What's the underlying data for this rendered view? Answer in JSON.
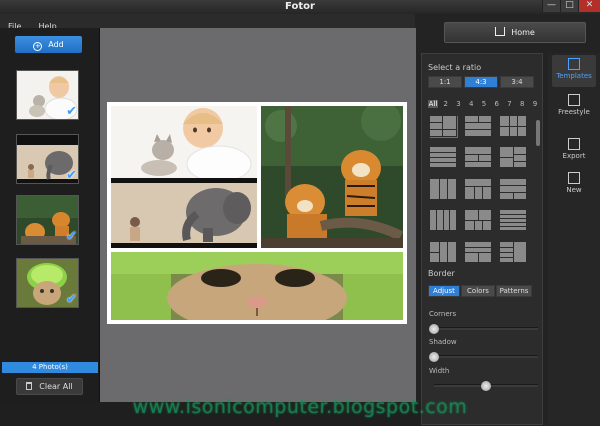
{
  "app": {
    "title": "Fotor"
  },
  "window_buttons": [
    "—",
    "□",
    "✕"
  ],
  "menu": [
    "File",
    "Help"
  ],
  "left": {
    "add_label": "Add",
    "photo_count": "4 Photo(s)",
    "clear_label": "Clear All",
    "thumbnails": [
      {
        "name": "baby-kitten",
        "checked": true
      },
      {
        "name": "child-elephant",
        "checked": true
      },
      {
        "name": "tigers",
        "checked": true
      },
      {
        "name": "cat-melon-helmet",
        "checked": true
      }
    ]
  },
  "home": {
    "label": "Home"
  },
  "templates": {
    "ratio_title": "Select a ratio",
    "ratios": [
      {
        "label": "1:1",
        "active": false
      },
      {
        "label": "4:3",
        "active": true
      },
      {
        "label": "3:4",
        "active": false
      }
    ],
    "counts": [
      "All",
      "2",
      "3",
      "4",
      "5",
      "6",
      "7",
      "8",
      "9"
    ],
    "active_count": "All",
    "border_title": "Border",
    "border_tabs": [
      {
        "label": "Adjust",
        "active": true
      },
      {
        "label": "Colors",
        "active": false
      },
      {
        "label": "Patterns",
        "active": false
      }
    ],
    "sliders": [
      {
        "label": "Corners",
        "value": 0
      },
      {
        "label": "Shadow",
        "value": 0
      },
      {
        "label": "Width",
        "value": 0.5
      }
    ]
  },
  "side_tabs": [
    {
      "label": "Templates",
      "icon": "templates-icon",
      "active": true
    },
    {
      "label": "Freestyle",
      "icon": "freestyle-icon",
      "active": false
    },
    {
      "label": "Export",
      "icon": "export-icon",
      "active": false
    },
    {
      "label": "New",
      "icon": "new-icon",
      "active": false
    }
  ],
  "watermark": "www.isonicomputer.blogspot.com",
  "colors": {
    "accent": "#2f7fd6",
    "canvas": "#6b6b6d",
    "panel": "#2c2c2c"
  }
}
